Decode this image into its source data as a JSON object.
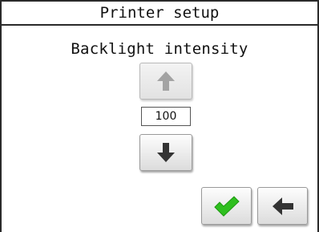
{
  "window": {
    "title": "Printer setup"
  },
  "setting": {
    "label": "Backlight intensity",
    "value": "100",
    "increase_enabled": false
  },
  "icons": {
    "increase": "arrow-up-icon",
    "decrease": "arrow-down-icon",
    "confirm": "checkmark-icon",
    "back": "arrow-left-icon"
  },
  "colors": {
    "border": "#2a2a2a",
    "arrow_enabled": "#333333",
    "arrow_disabled": "#a3a3a3",
    "confirm_green": "#2fbf1f"
  }
}
